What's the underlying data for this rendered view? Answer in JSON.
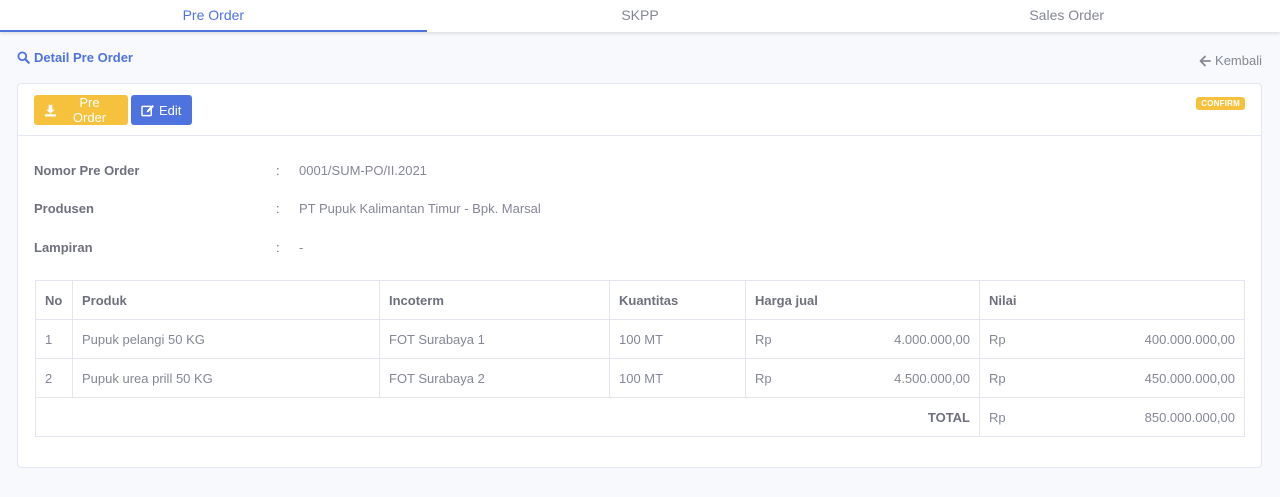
{
  "tabs": [
    {
      "label": "Pre Order",
      "active": true
    },
    {
      "label": "SKPP",
      "active": false
    },
    {
      "label": "Sales Order",
      "active": false
    }
  ],
  "header": {
    "title": "Detail Pre Order",
    "back_label": "Kembali"
  },
  "toolbar": {
    "pre_order_label": "Pre Order",
    "edit_label": "Edit",
    "status_badge": "CONFIRM"
  },
  "details": {
    "nomor": {
      "label": "Nomor Pre Order",
      "value": "0001/SUM-PO/II.2021"
    },
    "produsen": {
      "label": "Produsen",
      "value": "PT Pupuk Kalimantan Timur - Bpk. Marsal"
    },
    "lampiran": {
      "label": "Lampiran",
      "value": "-"
    },
    "separator": ":"
  },
  "table": {
    "columns": [
      "No",
      "Produk",
      "Incoterm",
      "Kuantitas",
      "Harga jual",
      "Nilai"
    ],
    "rows": [
      {
        "no": "1",
        "produk": "Pupuk pelangi 50 KG",
        "incoterm": "FOT Surabaya 1",
        "kuantitas": "100 MT",
        "harga_cur": "Rp",
        "harga": "4.000.000,00",
        "nilai_cur": "Rp",
        "nilai": "400.000.000,00"
      },
      {
        "no": "2",
        "produk": "Pupuk urea prill 50 KG",
        "incoterm": "FOT Surabaya 2",
        "kuantitas": "100 MT",
        "harga_cur": "Rp",
        "harga": "4.500.000,00",
        "nilai_cur": "Rp",
        "nilai": "450.000.000,00"
      }
    ],
    "total": {
      "label": "TOTAL",
      "currency": "Rp",
      "value": "850.000.000,00"
    }
  },
  "colors": {
    "primary": "#4e73df",
    "warning": "#f6c23e"
  }
}
